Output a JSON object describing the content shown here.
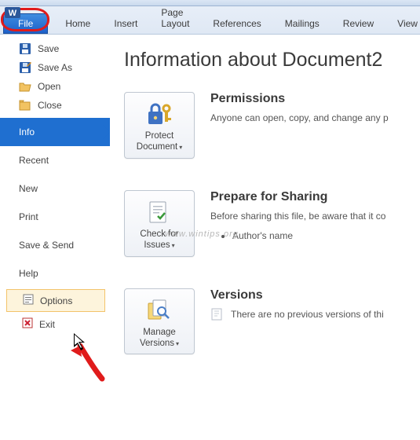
{
  "app": {
    "name": "Microsoft Word"
  },
  "ribbon": {
    "tabs": [
      "File",
      "Home",
      "Insert",
      "Page Layout",
      "References",
      "Mailings",
      "Review",
      "View"
    ]
  },
  "sidebar": {
    "file_ops": [
      {
        "label": "Save",
        "icon": "save-icon"
      },
      {
        "label": "Save As",
        "icon": "save-as-icon"
      },
      {
        "label": "Open",
        "icon": "open-folder-icon"
      },
      {
        "label": "Close",
        "icon": "close-folder-icon"
      }
    ],
    "nav": [
      "Info",
      "Recent",
      "New",
      "Print",
      "Save & Send",
      "Help"
    ],
    "selected_nav": "Info",
    "options_label": "Options",
    "exit_label": "Exit",
    "highlighted_item": "Options"
  },
  "content": {
    "title": "Information about Document2",
    "permissions": {
      "button_label": "Protect\nDocument",
      "title": "Permissions",
      "desc": "Anyone can open, copy, and change any p"
    },
    "sharing": {
      "button_label": "Check for\nIssues",
      "title": "Prepare for Sharing",
      "desc": "Before sharing this file, be aware that it co",
      "bullets": [
        "Author's name"
      ]
    },
    "versions": {
      "button_label": "Manage\nVersions",
      "title": "Versions",
      "desc": "There are no previous versions of thi"
    }
  },
  "watermark": "www.wintips.org",
  "colors": {
    "accent": "#1f6fd0",
    "highlight_ring": "#e01b1b"
  }
}
